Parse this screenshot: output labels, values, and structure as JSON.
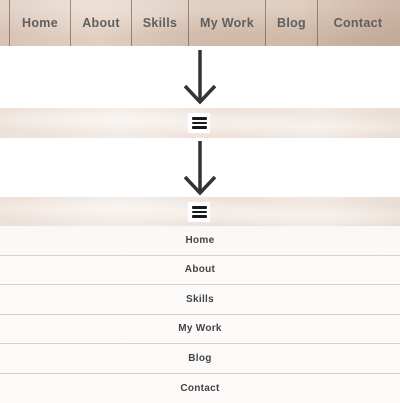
{
  "desktop_nav": {
    "items": [
      {
        "label": "Home"
      },
      {
        "label": "About"
      },
      {
        "label": "Skills"
      },
      {
        "label": "My Work"
      },
      {
        "label": "Blog"
      },
      {
        "label": "Contact"
      }
    ]
  },
  "collapsed_menu": {
    "icon": "hamburger-menu-icon"
  },
  "arrows": {
    "icon": "arrow-down-icon",
    "color": "#333333"
  },
  "mobile_menu": {
    "items": [
      {
        "label": "Home"
      },
      {
        "label": "About"
      },
      {
        "label": "Skills"
      },
      {
        "label": "My Work"
      },
      {
        "label": "Blog"
      },
      {
        "label": "Contact"
      }
    ]
  }
}
